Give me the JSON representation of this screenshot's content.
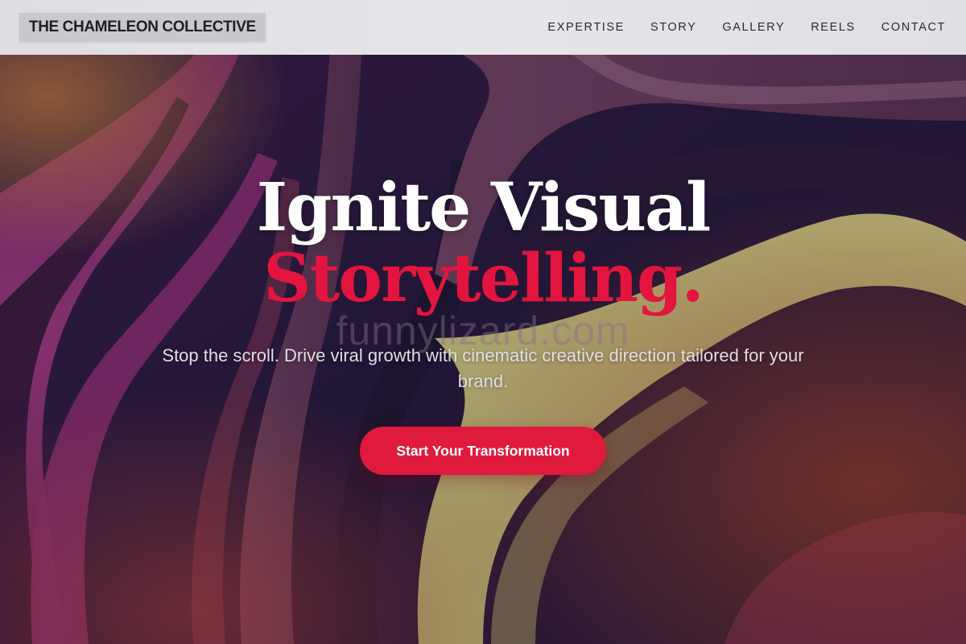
{
  "header": {
    "brand": "THE CHAMELEON COLLECTIVE",
    "nav": [
      {
        "label": "EXPERTISE"
      },
      {
        "label": "STORY"
      },
      {
        "label": "GALLERY"
      },
      {
        "label": "REELS"
      },
      {
        "label": "CONTACT"
      }
    ]
  },
  "hero": {
    "headline_line1": "Ignite Visual",
    "headline_line2": "Storytelling.",
    "watermark": "funnylizard.com",
    "subtitle": "Stop the scroll. Drive viral growth with cinematic creative direction tailored for your brand.",
    "cta_label": "Start Your Transformation"
  },
  "colors": {
    "accent": "#e01a3d",
    "headline_accent": "#e3153e",
    "header_bg": "#e3e2e8",
    "hero_dark": "#241a3a",
    "hero_magenta": "#8c2a6e",
    "hero_olive": "#c9c57a"
  }
}
